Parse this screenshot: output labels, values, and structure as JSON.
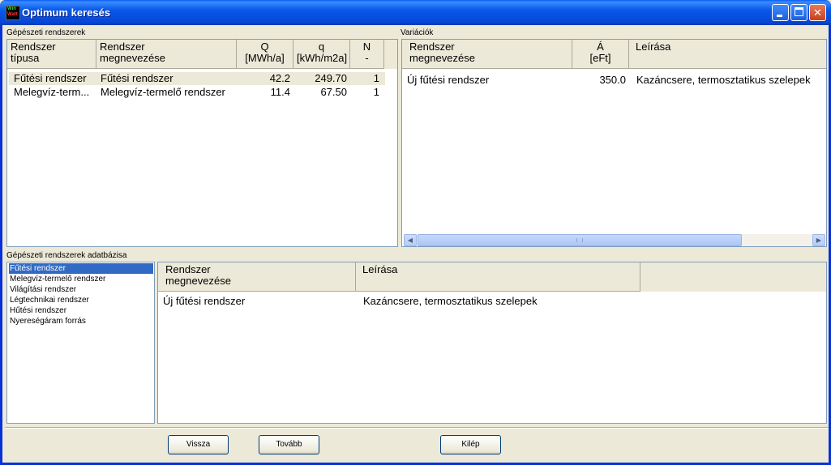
{
  "window": {
    "title": "Optimum keresés",
    "icon_name": "app-logo-icon",
    "icon_lines": [
      "Win",
      "Watt"
    ],
    "controls": {
      "minimize": "minimize-icon",
      "maximize": "maximize-icon",
      "close": "✕"
    }
  },
  "systems": {
    "label": "Gépészeti rendszerek",
    "headers": {
      "type": [
        "Rendszer",
        "típusa"
      ],
      "name": [
        "Rendszer",
        "megnevezése"
      ],
      "Q": [
        "Q",
        "[MWh/a]"
      ],
      "q": [
        "q",
        "[kWh/m2a]"
      ],
      "N": [
        "N",
        "-"
      ]
    },
    "rows": [
      {
        "type": "Fűtési rendszer",
        "name": "Fűtési rendszer",
        "Q": "42.2",
        "q": "249.70",
        "N": "1"
      },
      {
        "type": "Melegvíz-term...",
        "name": "Melegvíz-termelő rendszer",
        "Q": "11.4",
        "q": "67.50",
        "N": "1"
      }
    ]
  },
  "variations": {
    "label": "Variációk",
    "headers": {
      "name": [
        "Rendszer",
        "megnevezése"
      ],
      "price": [
        "Á",
        "[eFt]"
      ],
      "desc": [
        "Leírása",
        ""
      ]
    },
    "rows": [
      {
        "name": "Új fűtési rendszer",
        "price": "350.0",
        "desc": "Kazáncsere, termosztatikus szelepek"
      }
    ]
  },
  "database": {
    "label": "Gépészeti rendszerek adatbázisa",
    "items": [
      "Fűtési rendszer",
      "Melegvíz-termelő rendszer",
      "Világítási rendszer",
      "Légtechnikai rendszer",
      "Hűtési rendszer",
      "Nyereségáram forrás"
    ],
    "selected_index": 0,
    "headers": {
      "name": [
        "Rendszer",
        "megnevezése"
      ],
      "desc": [
        "Leírása",
        ""
      ]
    },
    "rows": [
      {
        "name": "Új fűtési rendszer",
        "desc": "Kazáncsere, termosztatikus szelepek"
      }
    ]
  },
  "buttons": {
    "back": "Vissza",
    "next": "Tovább",
    "exit": "Kilép"
  },
  "colors": {
    "title_bar": "#0a58ea",
    "selection": "#316ac5",
    "face": "#ece9d8"
  }
}
